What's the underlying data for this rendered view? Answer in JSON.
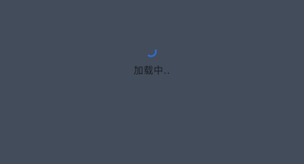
{
  "loading": {
    "text": "加载中..",
    "spinner_icon": "spinner-icon",
    "spinner_color": "#2f6fd6",
    "background_color": "#434c5b"
  }
}
